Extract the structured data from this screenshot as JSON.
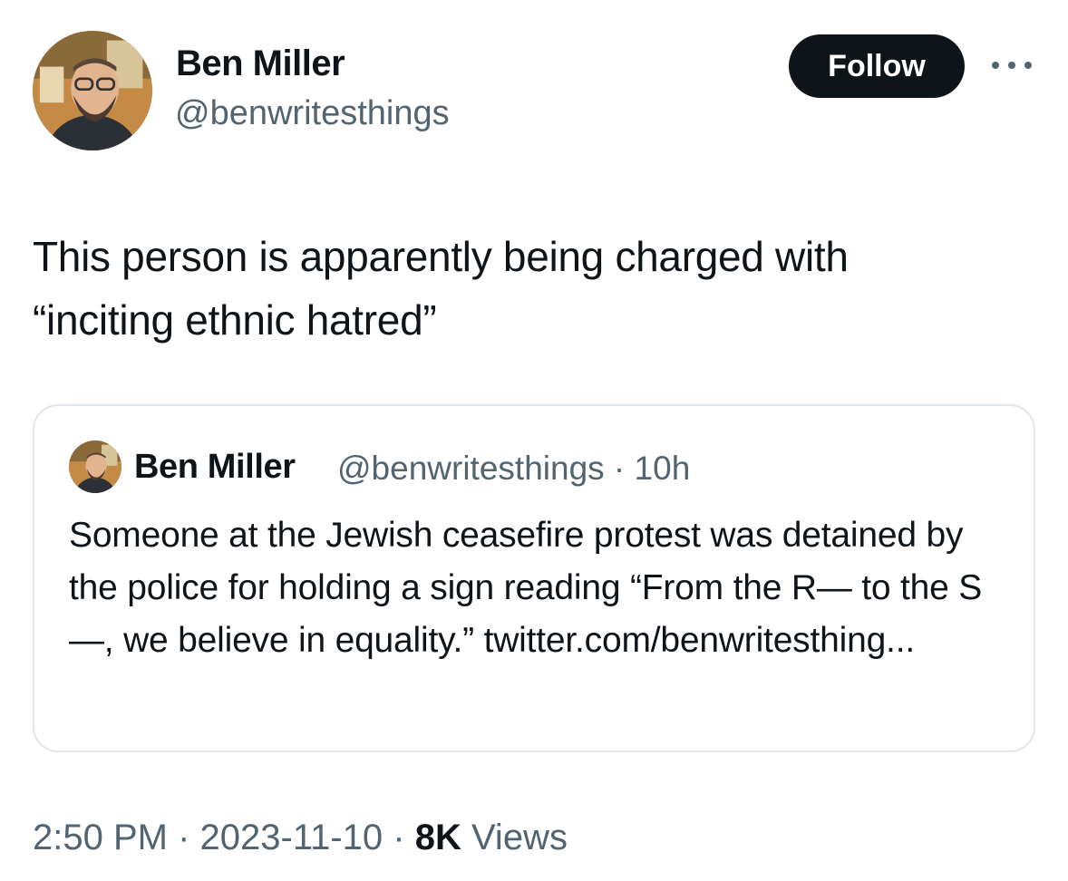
{
  "author": {
    "name": "Ben Miller",
    "handle": "@benwritesthings",
    "avatar_icon": "profile-photo"
  },
  "actions": {
    "follow_label": "Follow",
    "more_icon": "more-horizontal-icon"
  },
  "tweet": {
    "text": "This person is apparently being charged with\n“inciting ethnic hatred”"
  },
  "quoted": {
    "name": "Ben Miller",
    "handle": "@benwritesthings",
    "separator": " · ",
    "time": "10h",
    "text": "Someone at the Jewish ceasefire protest was detained by the police for holding a sign reading “From the R— to the S—, we believe in equality.” twitter.com/benwritesthing..."
  },
  "meta": {
    "time": "2:50 PM",
    "separator": " · ",
    "date": "2023-11-10",
    "views_count": "8K",
    "views_label": "Views"
  },
  "colors": {
    "text": "#0f1419",
    "secondary": "#536471",
    "border": "#e1e6ea",
    "button_bg": "#0f1419"
  }
}
